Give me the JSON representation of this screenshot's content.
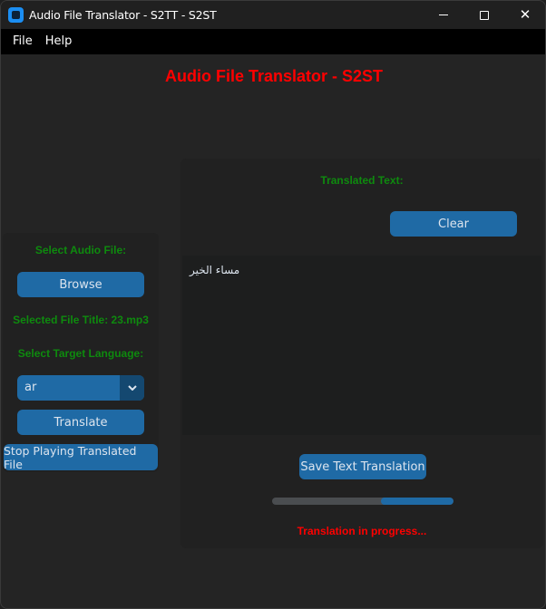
{
  "window": {
    "title": "Audio File Translator - S2TT - S2ST",
    "controls": {
      "minimize": "minimize",
      "maximize": "maximize",
      "close": "✕"
    }
  },
  "menu": {
    "items": [
      "File",
      "Help"
    ]
  },
  "header": {
    "title": "Audio File Translator - S2ST"
  },
  "left_panel": {
    "select_audio_label": "Select Audio File:",
    "browse_button": "Browse",
    "selected_file": "Selected File Title: 23.mp3",
    "target_language_label": "Select Target Language:",
    "language_select": {
      "value": "ar",
      "arrow": "⌄"
    },
    "translate_button": "Translate",
    "stop_button": "Stop Playing Translated File"
  },
  "right_panel": {
    "translated_label": "Translated Text:",
    "clear_button": "Clear",
    "translated_text": "مساء الخير",
    "save_button": "Save Text Translation",
    "progress": {
      "start": 0.6,
      "end": 1.0,
      "mode": "indeterminate"
    },
    "status": "Translation in progress..."
  },
  "colors": {
    "accent": "#1f6aa5",
    "label_green": "#0e8a0e",
    "title_red": "#ff0000",
    "background": "#242424"
  }
}
